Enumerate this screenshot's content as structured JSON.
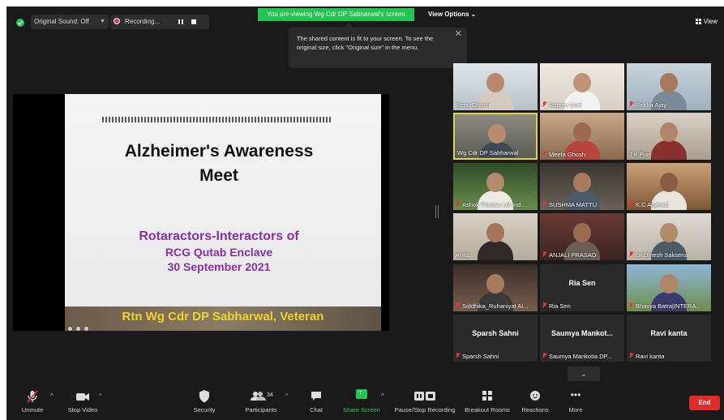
{
  "topbar": {
    "sound_label": "Original Sound: Off",
    "recording_label": "Recording...",
    "viewing_banner": "You are viewing Wg Cdr DP Sabharwal's screen",
    "view_options": "View Options ⌄",
    "view_button": "View"
  },
  "tooltip": {
    "text": "The shared content is fit to your screen. To see the original size, click \"Original size\" in the menu."
  },
  "slide": {
    "title_line1": "Alzheimer's Awareness",
    "title_line2": "Meet",
    "subtitle_line1": "Rotaractors-Interactors of",
    "subtitle_line2": "RCG Qutab Enclave",
    "subtitle_line3": "30 September 2021",
    "footer": "Rtn Wg Cdr DP Sabharwal, Veteran"
  },
  "participants": [
    {
      "name": "Renu Ghosh",
      "muted": false
    },
    {
      "name": "Rajeev Goel",
      "muted": true
    },
    {
      "name": "Rekha Ajay",
      "muted": true
    },
    {
      "name": "Wg Cdr DP Sabharwal",
      "muted": false
    },
    {
      "name": "Meeta Ghosh",
      "muted": true
    },
    {
      "name": "J K Puri",
      "muted": false
    },
    {
      "name": "Ashok Thussu LM Ind...",
      "muted": true
    },
    {
      "name": "SUSHMA MATTU",
      "muted": true
    },
    {
      "name": "K.C Agarwal",
      "muted": true
    },
    {
      "name": "Ahila",
      "muted": false
    },
    {
      "name": "ANJALI PRASAD",
      "muted": true
    },
    {
      "name": "Dr Dinesh Saksena",
      "muted": true
    },
    {
      "name": "Siddhika_Ruhaniyat Al...",
      "muted": true
    },
    {
      "name": "Ria Sen",
      "muted": true,
      "display": "Ria Sen"
    },
    {
      "name": "Bhavya Batra|INTERA...",
      "muted": true
    },
    {
      "name": "Sparsh Sahni",
      "muted": true,
      "display": "Sparsh Sahni"
    },
    {
      "name": "Saumya Mankotia DP...",
      "muted": true,
      "display": "Saumya  Mankot..."
    },
    {
      "name": "Ravi kanta",
      "muted": true,
      "display": "Ravi kanta"
    }
  ],
  "toolbar": {
    "unmute": "Unmute",
    "stop_video": "Stop Video",
    "security": "Security",
    "participants": "Participants",
    "participants_count": "34",
    "chat": "Chat",
    "share_screen": "Share Screen",
    "pause_recording": "Pause/Stop Recording",
    "breakout_rooms": "Breakout Rooms",
    "reactions": "Reactions",
    "more": "More",
    "end": "End"
  },
  "colors": {
    "accent_green": "#23c552",
    "end_red": "#e02b2b",
    "slide_purple": "#8b2fa8",
    "slide_footer_yellow": "#f3d12b",
    "active_speaker": "#e4d23a"
  }
}
